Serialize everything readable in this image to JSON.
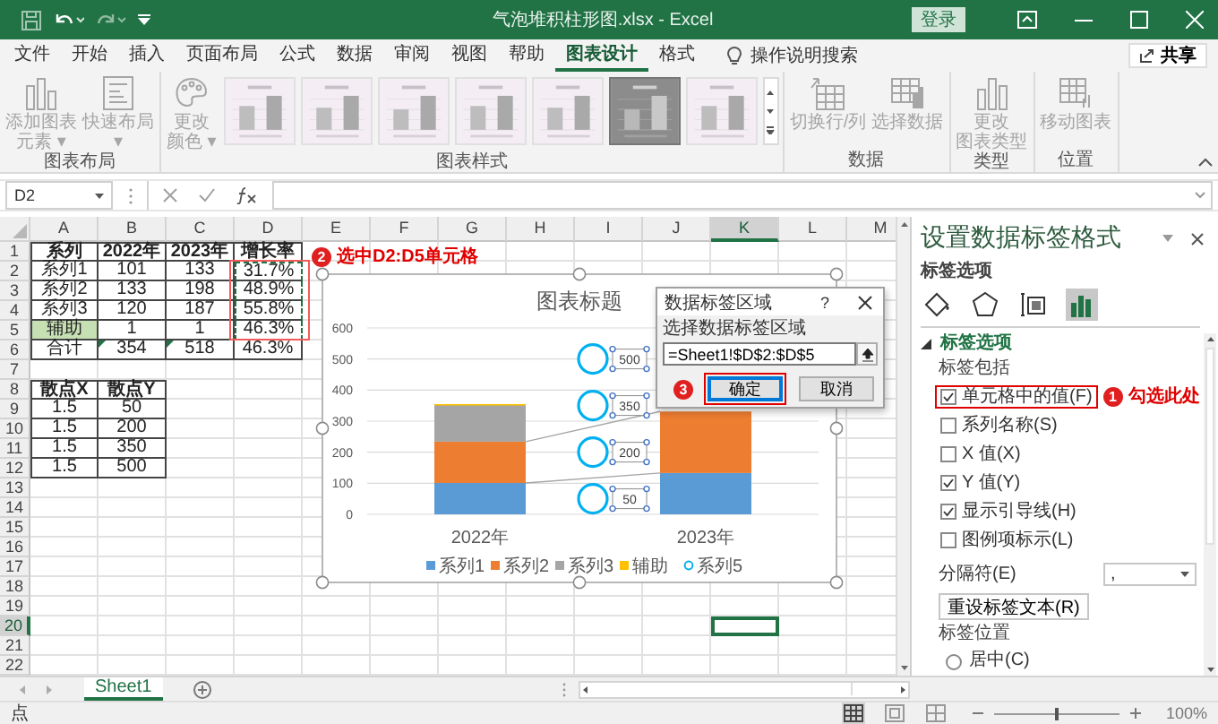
{
  "title_bar": {
    "file_title": "气泡堆积柱形图.xlsx  -  Excel",
    "sign_in": "登录"
  },
  "ribbon_tabs": [
    {
      "label": "文件",
      "selected": false
    },
    {
      "label": "开始",
      "selected": false
    },
    {
      "label": "插入",
      "selected": false
    },
    {
      "label": "页面布局",
      "selected": false
    },
    {
      "label": "公式",
      "selected": false
    },
    {
      "label": "数据",
      "selected": false
    },
    {
      "label": "审阅",
      "selected": false
    },
    {
      "label": "视图",
      "selected": false
    },
    {
      "label": "帮助",
      "selected": false
    },
    {
      "label": "图表设计",
      "selected": true
    },
    {
      "label": "格式",
      "selected": false
    }
  ],
  "tell_me": "操作说明搜索",
  "share": "共享",
  "ribbon_groups": [
    {
      "label": "图表布局",
      "buttons": [
        {
          "kind": "add-element",
          "lines": [
            "添加图表",
            "元素 ▾"
          ],
          "disabled": true
        },
        {
          "kind": "layout",
          "lines": [
            "快速布局",
            "▾"
          ],
          "disabled": true
        }
      ]
    },
    {
      "label": "图表样式",
      "buttons": [
        {
          "kind": "palette",
          "lines": [
            "更改",
            "颜色 ▾"
          ],
          "disabled": true
        }
      ],
      "gallery": [
        {
          "selected": false
        },
        {
          "selected": false
        },
        {
          "selected": false
        },
        {
          "selected": false
        },
        {
          "selected": false
        },
        {
          "selected": true
        },
        {
          "selected": false
        }
      ]
    },
    {
      "label": "数据",
      "buttons": [
        {
          "kind": "switch",
          "lines": [
            "切换行/列"
          ],
          "disabled": true
        },
        {
          "kind": "select-data",
          "lines": [
            "选择数据"
          ],
          "disabled": true
        }
      ]
    },
    {
      "label": "类型",
      "buttons": [
        {
          "kind": "chart-type",
          "lines": [
            "更改",
            "图表类型"
          ],
          "disabled": true
        }
      ]
    },
    {
      "label": "位置",
      "buttons": [
        {
          "kind": "move",
          "lines": [
            "移动图表"
          ],
          "disabled": true
        }
      ]
    }
  ],
  "formula_bar": {
    "name_box": "D2"
  },
  "sheet": {
    "columns": [
      {
        "label": "A",
        "selected": false
      },
      {
        "label": "B",
        "selected": false
      },
      {
        "label": "C",
        "selected": false
      },
      {
        "label": "D",
        "selected": false
      },
      {
        "label": "E",
        "selected": false
      },
      {
        "label": "F",
        "selected": false
      },
      {
        "label": "G",
        "selected": false
      },
      {
        "label": "H",
        "selected": false
      },
      {
        "label": "I",
        "selected": false
      },
      {
        "label": "J",
        "selected": false
      },
      {
        "label": "K",
        "selected": true
      },
      {
        "label": "L",
        "selected": false
      },
      {
        "label": "M",
        "selected": false
      }
    ],
    "rows": [
      {
        "label": "1",
        "selected": false
      },
      {
        "label": "2",
        "selected": false
      },
      {
        "label": "3",
        "selected": false
      },
      {
        "label": "4",
        "selected": false
      },
      {
        "label": "5",
        "selected": false
      },
      {
        "label": "6",
        "selected": false
      },
      {
        "label": "7",
        "selected": false
      },
      {
        "label": "8",
        "selected": false
      },
      {
        "label": "9",
        "selected": false
      },
      {
        "label": "10",
        "selected": false
      },
      {
        "label": "11",
        "selected": false
      },
      {
        "label": "12",
        "selected": false
      },
      {
        "label": "13",
        "selected": false
      },
      {
        "label": "14",
        "selected": false
      },
      {
        "label": "15",
        "selected": false
      },
      {
        "label": "16",
        "selected": false
      },
      {
        "label": "17",
        "selected": false
      },
      {
        "label": "18",
        "selected": false
      },
      {
        "label": "19",
        "selected": false
      },
      {
        "label": "20",
        "selected": true
      },
      {
        "label": "21",
        "selected": false
      },
      {
        "label": "22",
        "selected": false
      }
    ],
    "table_1": {
      "rows": [
        {
          "kind": "header",
          "cells": [
            "系列",
            "2022年",
            "2023年",
            "增长率"
          ],
          "selected": false,
          "warning": false
        },
        {
          "kind": "data",
          "cells": [
            "系列1",
            "101",
            "133",
            "31.7%"
          ],
          "selected": true,
          "warning": false
        },
        {
          "kind": "data",
          "cells": [
            "系列2",
            "133",
            "198",
            "48.9%"
          ],
          "selected": true,
          "warning": false
        },
        {
          "kind": "data",
          "cells": [
            "系列3",
            "120",
            "187",
            "55.8%"
          ],
          "selected": true,
          "warning": false
        },
        {
          "kind": "helper",
          "cells": [
            "辅助",
            "1",
            "1",
            "46.3%"
          ],
          "selected": true,
          "warning": false
        },
        {
          "kind": "data",
          "cells": [
            "合计",
            "354",
            "518",
            "46.3%"
          ],
          "selected": false,
          "warning": true
        }
      ]
    },
    "table_2": {
      "rows": [
        {
          "kind": "header",
          "cells": [
            "散点X",
            "散点Y"
          ]
        },
        {
          "kind": "data",
          "cells": [
            "1.5",
            "50"
          ]
        },
        {
          "kind": "data",
          "cells": [
            "1.5",
            "200"
          ]
        },
        {
          "kind": "data",
          "cells": [
            "1.5",
            "350"
          ]
        },
        {
          "kind": "data",
          "cells": [
            "1.5",
            "500"
          ]
        }
      ]
    },
    "callout": {
      "number": "2",
      "text": "选中D2:D5单元格"
    }
  },
  "chart": {
    "chart_data": {
      "type": "bar",
      "title": "图表标题",
      "categories": [
        "2022年",
        "2023年"
      ],
      "stacked": true,
      "grid": true,
      "legend": "bottom",
      "ylim": [
        0,
        600
      ],
      "yticks": [
        0,
        100,
        200,
        300,
        400,
        500,
        600
      ],
      "series": [
        {
          "name": "系列1",
          "color": "#5b9bd5",
          "values": [
            101,
            133
          ]
        },
        {
          "name": "系列2",
          "color": "#ed7d31",
          "values": [
            133,
            198
          ]
        },
        {
          "name": "系列3",
          "color": "#a5a5a5",
          "values": [
            120,
            null
          ]
        },
        {
          "name": "辅助",
          "color": "#ffc000",
          "values": [
            1,
            null
          ]
        },
        {
          "name": "系列5",
          "color": "#00b0f0",
          "values": [
            null,
            null
          ]
        }
      ]
    },
    "point_labels": [
      "500",
      "350",
      "200",
      "50"
    ]
  },
  "dialog": {
    "title": "数据标签区域",
    "help": "?",
    "prompt": "选择数据标签区域",
    "value": "=Sheet1!$D$2:$D$5",
    "buttons": [
      {
        "label": "确定",
        "focused": true,
        "highlighted": true
      },
      {
        "label": "取消",
        "focused": false,
        "highlighted": false
      }
    ],
    "callout": {
      "number": "3"
    }
  },
  "pane": {
    "title": "设置数据标签格式",
    "options_menu": "标签选项",
    "icon_tabs": [
      {
        "kind": "fill",
        "selected": false
      },
      {
        "kind": "effects",
        "selected": false
      },
      {
        "kind": "size",
        "selected": false
      },
      {
        "kind": "options",
        "selected": true
      }
    ],
    "section": {
      "title": "标签选项",
      "expanded": true
    },
    "include_label": "标签包括",
    "checkboxes": [
      {
        "label": "单元格中的值(F)",
        "checked": true,
        "highlighted": true
      },
      {
        "label": "系列名称(S)",
        "checked": false,
        "highlighted": false
      },
      {
        "label": "X 值(X)",
        "checked": false,
        "highlighted": false
      },
      {
        "label": "Y 值(Y)",
        "checked": true,
        "highlighted": false
      },
      {
        "label": "显示引导线(H)",
        "checked": true,
        "highlighted": false
      },
      {
        "label": "图例项标示(L)",
        "checked": false,
        "highlighted": false
      }
    ],
    "callout": {
      "number": "1",
      "text": "勾选此处"
    },
    "separator": {
      "label": "分隔符(E)",
      "value": ","
    },
    "reset_button": "重设标签文本(R)",
    "position_label": "标签位置",
    "radios": [
      {
        "label": "居中(C)",
        "selected": false
      }
    ]
  },
  "sheet_tabs": [
    {
      "label": "Sheet1",
      "selected": true
    }
  ],
  "status_bar": {
    "mode": "点",
    "views": [
      {
        "kind": "normal",
        "selected": true
      },
      {
        "kind": "page-layout",
        "selected": false
      },
      {
        "kind": "page-break",
        "selected": false
      }
    ],
    "zoom": {
      "level": 0.5,
      "reading": "100%"
    }
  }
}
